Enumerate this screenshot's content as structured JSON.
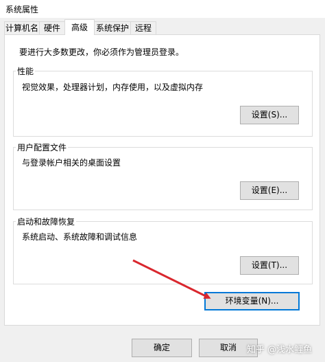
{
  "window": {
    "title": "系统属性"
  },
  "tabs": [
    {
      "label": "计算机名"
    },
    {
      "label": "硬件"
    },
    {
      "label": "高级",
      "active": true
    },
    {
      "label": "系统保护"
    },
    {
      "label": "远程"
    }
  ],
  "note": "要进行大多数更改，你必须作为管理员登录。",
  "groups": {
    "performance": {
      "title": "性能",
      "desc": "视觉效果，处理器计划，内存使用，以及虚拟内存",
      "button": "设置(S)..."
    },
    "profile": {
      "title": "用户配置文件",
      "desc": "与登录帐户相关的桌面设置",
      "button": "设置(E)..."
    },
    "startup": {
      "title": "启动和故障恢复",
      "desc": "系统启动、系统故障和调试信息",
      "button": "设置(T)..."
    }
  },
  "env_button": "环境变量(N)...",
  "footer": {
    "ok": "确定",
    "cancel": "取消"
  },
  "watermark": "知乎 @浅水鲤鱼",
  "colors": {
    "arrow": "#d9272e",
    "focus": "#0078d7"
  }
}
